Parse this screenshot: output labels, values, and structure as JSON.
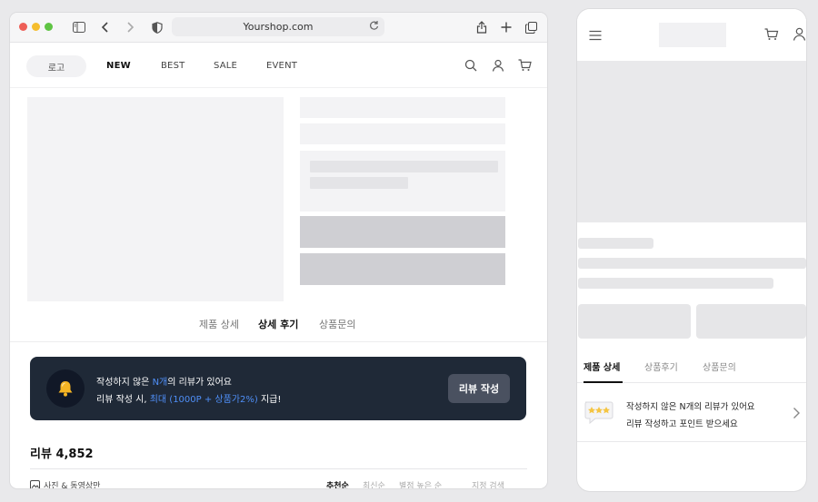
{
  "browser": {
    "url": "Yourshop.com"
  },
  "nav": {
    "logo": "로고",
    "links": [
      "NEW",
      "BEST",
      "SALE",
      "EVENT"
    ]
  },
  "product_tabs": {
    "detail": "제품 상세",
    "reviews": "상세 후기",
    "qna": "상품문의"
  },
  "review_banner": {
    "line1_pre": "작성하지 않은 ",
    "line1_highlight": "N개",
    "line1_post": "의 리뷰가 있어요",
    "line2_pre": "리뷰 작성 시, ",
    "line2_highlight": "최대 (1000P + 상품가2%)",
    "line2_post": " 지급!",
    "button": "리뷰 작성",
    "accent_color": "#4f8ff7"
  },
  "reviews": {
    "title": "리뷰 4,852",
    "photo_filter": "사진 & 동영상만",
    "sort_options": [
      "추천순",
      "최신순",
      "별점 높은 순",
      "별점 낮은 순"
    ],
    "search": "지정 검색"
  },
  "mobile": {
    "tabs": [
      "제품 상세",
      "상품후기",
      "상품문의"
    ],
    "review_prompt_line1": "작성하지 않은 N개의 리뷰가 있어요",
    "review_prompt_line2": "리뷰 작성하고 포인트 받으세요"
  }
}
